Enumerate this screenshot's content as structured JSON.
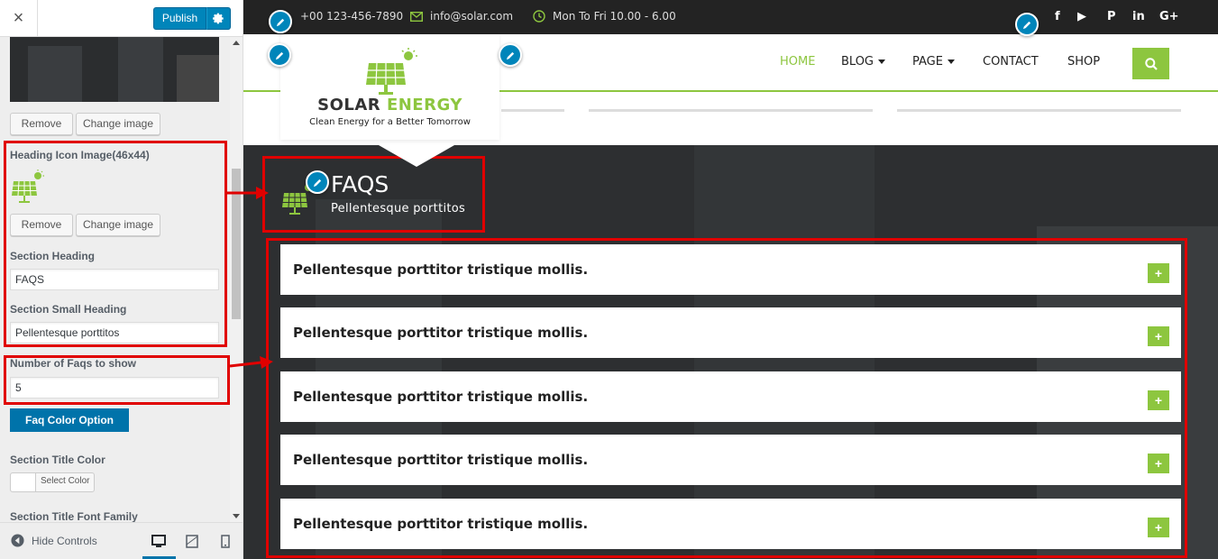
{
  "sidebar": {
    "close_icon": "×",
    "publish_label": "Publish",
    "remove_label": "Remove",
    "change_image_label": "Change image",
    "heading_icon_label": "Heading Icon Image(46x44)",
    "section_heading_label": "Section Heading",
    "section_heading_value": "FAQS",
    "section_small_heading_label": "Section Small Heading",
    "section_small_heading_value": "Pellentesque porttitos",
    "num_faqs_label": "Number of Faqs to show",
    "num_faqs_value": "5",
    "faq_color_option_label": "Faq Color Option",
    "section_title_color_label": "Section Title Color",
    "select_color_label": "Select Color",
    "section_title_font_label": "Section Title Font Family",
    "hide_controls_label": "Hide Controls",
    "accent_color": "#0085ba"
  },
  "topbar": {
    "phone": "+00 123-456-7890",
    "email": "info@solar.com",
    "hours": "Mon To Fri 10.00 - 6.00",
    "socials": [
      "f",
      "▶",
      "P",
      "in",
      "G+"
    ]
  },
  "nav": {
    "items": [
      "HOME",
      "BLOG",
      "PAGE",
      "CONTACT",
      "SHOP"
    ],
    "active": "HOME"
  },
  "logo": {
    "title_word1": "SOLAR",
    "title_word2": "ENERGY",
    "tagline": "Clean Energy for a Better Tomorrow"
  },
  "faq": {
    "title": "FAQS",
    "subtitle": "Pellentesque porttitos",
    "questions": [
      "Pellentesque porttitor tristique mollis.",
      "Pellentesque porttitor tristique mollis.",
      "Pellentesque porttitor tristique mollis.",
      "Pellentesque porttitor tristique mollis.",
      "Pellentesque porttitor tristique mollis."
    ],
    "plus": "+",
    "accent_color": "#8dc63f"
  }
}
